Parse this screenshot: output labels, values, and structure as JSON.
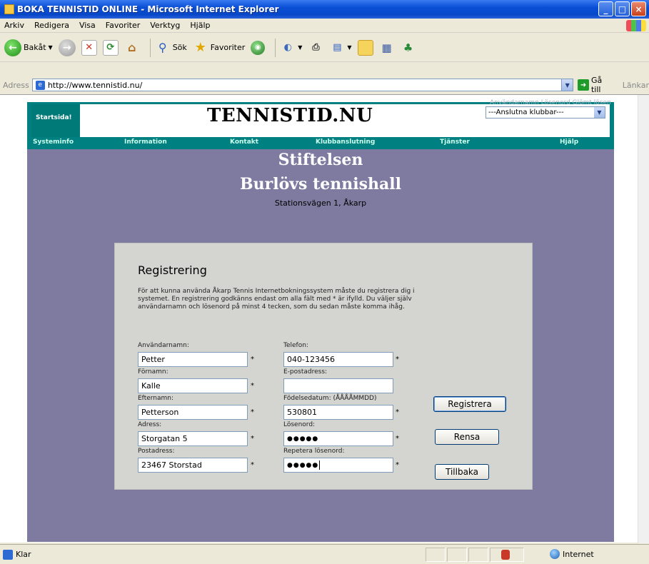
{
  "window": {
    "title": "BOKA TENNISTID ONLINE - Microsoft Internet Explorer"
  },
  "menu": [
    "Arkiv",
    "Redigera",
    "Visa",
    "Favoriter",
    "Verktyg",
    "Hjälp"
  ],
  "toolbar": {
    "back": "Bakåt",
    "search": "Sök",
    "favorites": "Favoriter"
  },
  "address": {
    "label": "Adress",
    "url": "http://www.tennistid.nu/",
    "go": "Gå till",
    "links": "Länkar"
  },
  "site": {
    "startsida": "Startsida!",
    "logo": "TENNISTID.NU",
    "club_select": "---Anslutna klubbar---",
    "cut_link": "Användarnamn Lösenord Glömt lösenord",
    "nav": [
      "Systeminfo",
      "Information",
      "Kontakt",
      "Klubbanslutning",
      "Tjänster",
      "Hjälp"
    ]
  },
  "venue": {
    "line1": "Stiftelsen",
    "line2": "Burlövs tennishall",
    "address": "Stationsvägen 1, Åkarp"
  },
  "registration": {
    "title": "Registrering",
    "description": "För att kunna använda Åkarp Tennis Internetbokningssystem måste du registrera dig i systemet. En registrering godkänns endast om alla fält med * är ifylld. Du väljer själv användarnamn och lösenord på minst 4 tecken, som du sedan måste komma ihåg.",
    "fields": {
      "username": {
        "label": "Användarnamn:",
        "value": "Petter"
      },
      "phone": {
        "label": "Telefon:",
        "value": "040-123456"
      },
      "firstname": {
        "label": "Förnamn:",
        "value": "Kalle"
      },
      "email": {
        "label": "E-postadress:",
        "value": ""
      },
      "lastname": {
        "label": "Efternamn:",
        "value": "Petterson"
      },
      "birthdate": {
        "label": "Födelsedatum: (ÅÅÅÅMMDD)",
        "value": "530801"
      },
      "street": {
        "label": "Adress:",
        "value": "Storgatan 5"
      },
      "password": {
        "label": "Lösenord:",
        "value": "●●●●●"
      },
      "postal": {
        "label": "Postadress:",
        "value": "23467 Storstad"
      },
      "password_repeat": {
        "label": "Repetera lösenord:",
        "value": "●●●●●"
      }
    },
    "required_mark": "*",
    "buttons": {
      "register": "Registrera",
      "clear": "Rensa",
      "back": "Tillbaka"
    }
  },
  "status": {
    "text": "Klar",
    "zone": "Internet"
  }
}
